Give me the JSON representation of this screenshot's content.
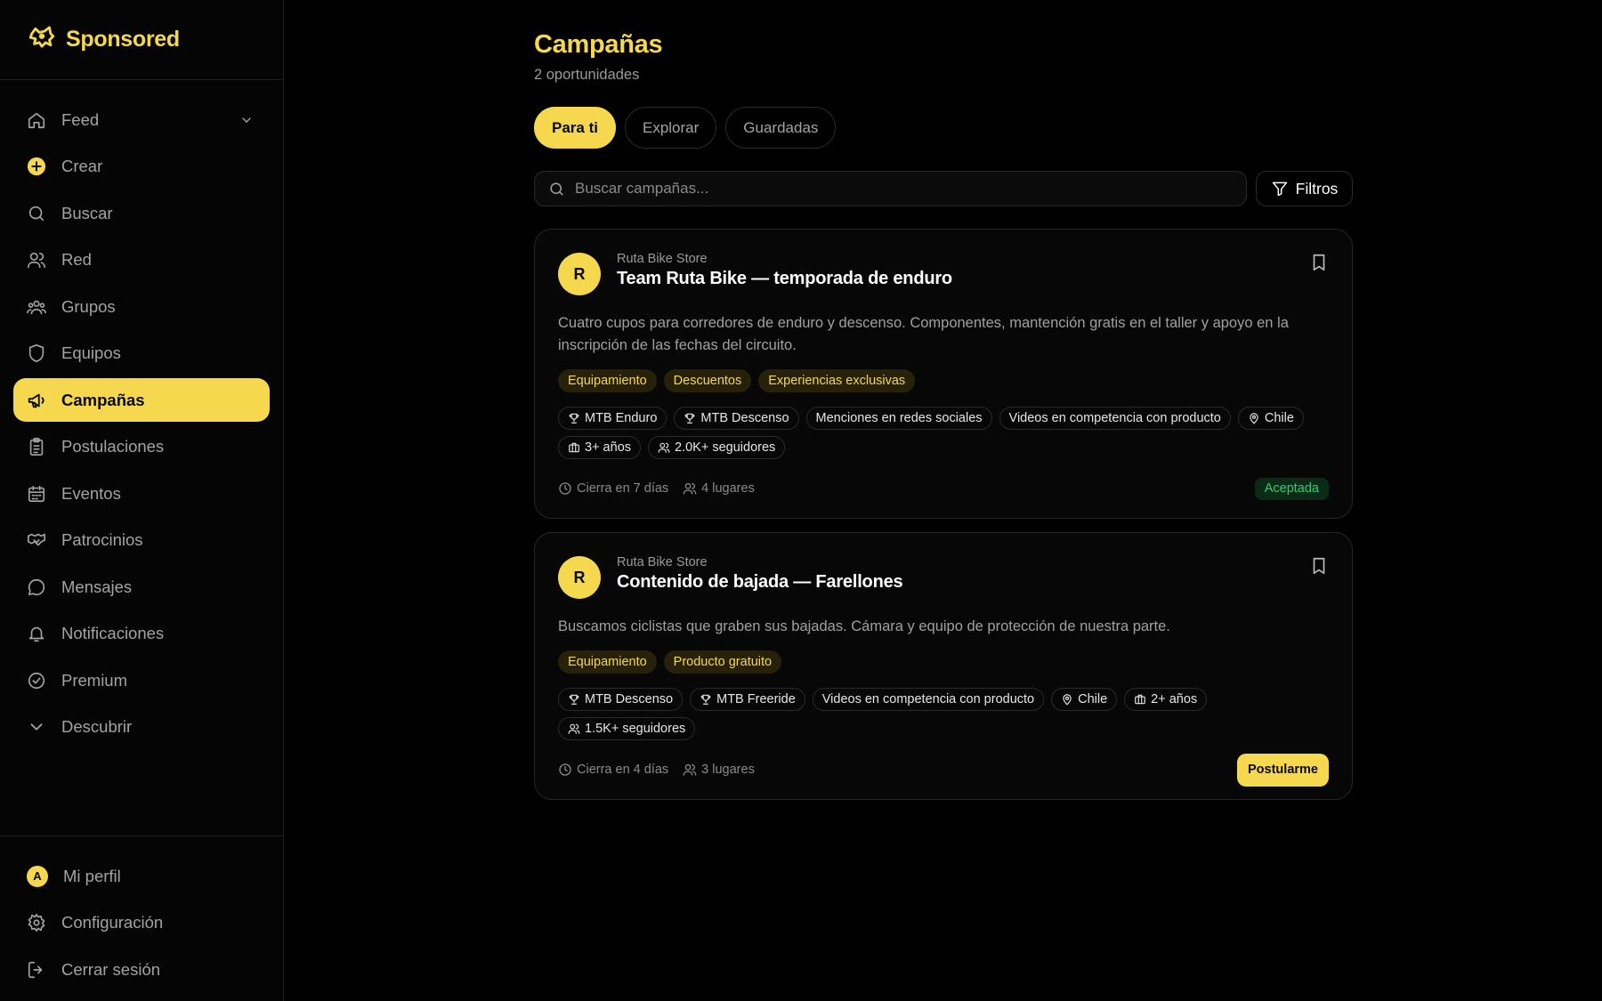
{
  "brand": {
    "name": "Sponsored",
    "logo_icon": "dog-head-icon"
  },
  "colors": {
    "accent": "#f5d84e",
    "background": "#000000",
    "success": "#2ecc71"
  },
  "sidebar": {
    "items": [
      {
        "label": "Feed",
        "icon": "home-icon"
      },
      {
        "label": "Crear",
        "icon": "plus-circle-icon"
      },
      {
        "label": "Buscar",
        "icon": "search-icon"
      },
      {
        "label": "Red",
        "icon": "users-icon"
      },
      {
        "label": "Grupos",
        "icon": "group-icon"
      },
      {
        "label": "Equipos",
        "icon": "shield-icon"
      },
      {
        "label": "Campañas",
        "icon": "megaphone-icon",
        "active": true
      },
      {
        "label": "Postulaciones",
        "icon": "clipboard-icon"
      },
      {
        "label": "Eventos",
        "icon": "calendar-icon"
      },
      {
        "label": "Patrocinios",
        "icon": "handshake-icon"
      },
      {
        "label": "Mensajes",
        "icon": "message-icon"
      },
      {
        "label": "Notificaciones",
        "icon": "bell-icon"
      },
      {
        "label": "Premium",
        "icon": "badge-check-icon"
      },
      {
        "label": "Descubrir",
        "icon": "chevron-down-icon"
      }
    ],
    "bottom": {
      "profile_label": "Mi perfil",
      "profile_initial": "A",
      "settings_label": "Configuración",
      "logout_label": "Cerrar sesión"
    }
  },
  "main": {
    "title": "Campañas",
    "subtitle": "2 oportunidades",
    "tabs": [
      {
        "label": "Para ti",
        "active": true
      },
      {
        "label": "Explorar"
      },
      {
        "label": "Guardadas"
      }
    ],
    "search": {
      "placeholder": "Buscar campañas..."
    },
    "filter_label": "Filtros",
    "cards": [
      {
        "initial": "R",
        "store": "Ruta Bike Store",
        "title": "Team Ruta Bike — temporada de enduro",
        "description": "Cuatro cupos para corredores de enduro y descenso. Componentes, mantención gratis en el taller y apoyo en la inscripción de las fechas del circuito.",
        "benefits": [
          "Equipamiento",
          "Descuentos",
          "Experiencias exclusivas"
        ],
        "requirements": [
          {
            "label": "MTB Enduro",
            "icon": "trophy-icon"
          },
          {
            "label": "MTB Descenso",
            "icon": "trophy-icon"
          },
          {
            "label": "Menciones en redes sociales",
            "icon": ""
          },
          {
            "label": "Videos en competencia con producto",
            "icon": ""
          },
          {
            "label": "Chile",
            "icon": "map-pin-icon"
          },
          {
            "label": "3+ años",
            "icon": "briefcase-icon"
          },
          {
            "label": "2.0K+ seguidores",
            "icon": "users-icon"
          }
        ],
        "closes": "Cierra en 7 días",
        "spots": "4 lugares",
        "status": "Aceptada"
      },
      {
        "initial": "R",
        "store": "Ruta Bike Store",
        "title": "Contenido de bajada — Farellones",
        "description": "Buscamos ciclistas que graben sus bajadas. Cámara y equipo de protección de nuestra parte.",
        "benefits": [
          "Equipamiento",
          "Producto gratuito"
        ],
        "requirements": [
          {
            "label": "MTB Descenso",
            "icon": "trophy-icon"
          },
          {
            "label": "MTB Freeride",
            "icon": "trophy-icon"
          },
          {
            "label": "Videos en competencia con producto",
            "icon": ""
          },
          {
            "label": "Chile",
            "icon": "map-pin-icon"
          },
          {
            "label": "2+ años",
            "icon": "briefcase-icon"
          },
          {
            "label": "1.5K+ seguidores",
            "icon": "users-icon"
          }
        ],
        "closes": "Cierra en 4 días",
        "spots": "3 lugares",
        "action": "Postularme"
      }
    ]
  }
}
